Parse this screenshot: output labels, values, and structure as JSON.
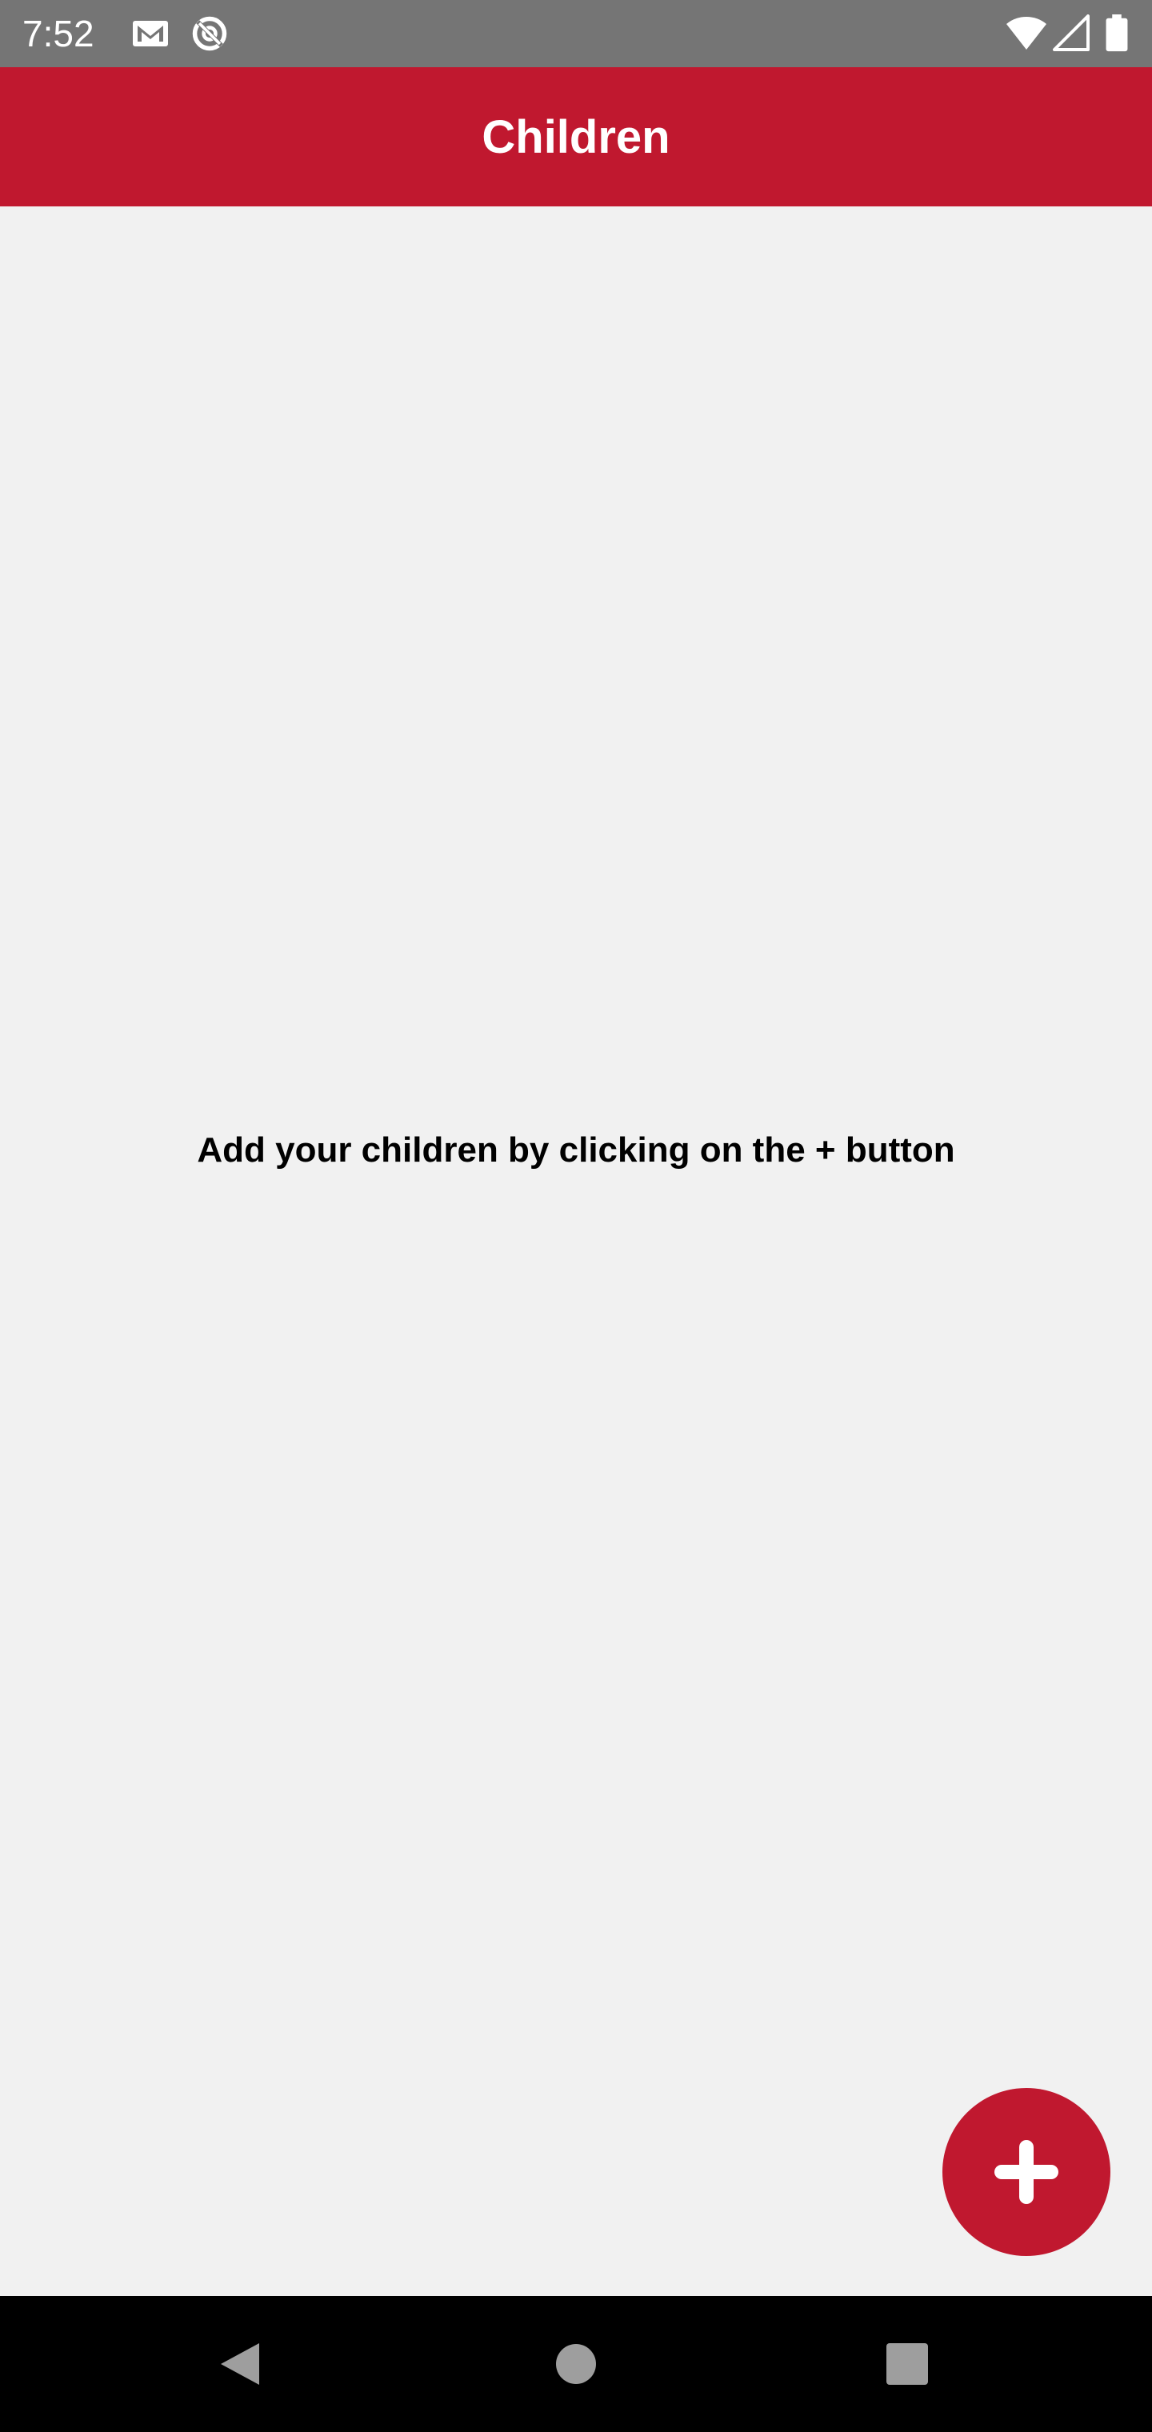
{
  "status_bar": {
    "time": "7:52",
    "left_icons": [
      "gmail-icon",
      "sync-icon"
    ],
    "right_icons": [
      "wifi-icon",
      "cellular-signal-icon",
      "battery-icon"
    ]
  },
  "app_bar": {
    "title": "Children"
  },
  "main": {
    "empty_message": "Add your children by clicking on the + button"
  },
  "fab": {
    "icon": "plus-icon"
  },
  "navigation_bar": {
    "buttons": [
      "back-icon",
      "home-icon",
      "recents-icon"
    ]
  },
  "colors": {
    "status_bar": "#757575",
    "accent": "#c0182f",
    "background": "#f1f1f1",
    "nav_bar": "#000000"
  }
}
